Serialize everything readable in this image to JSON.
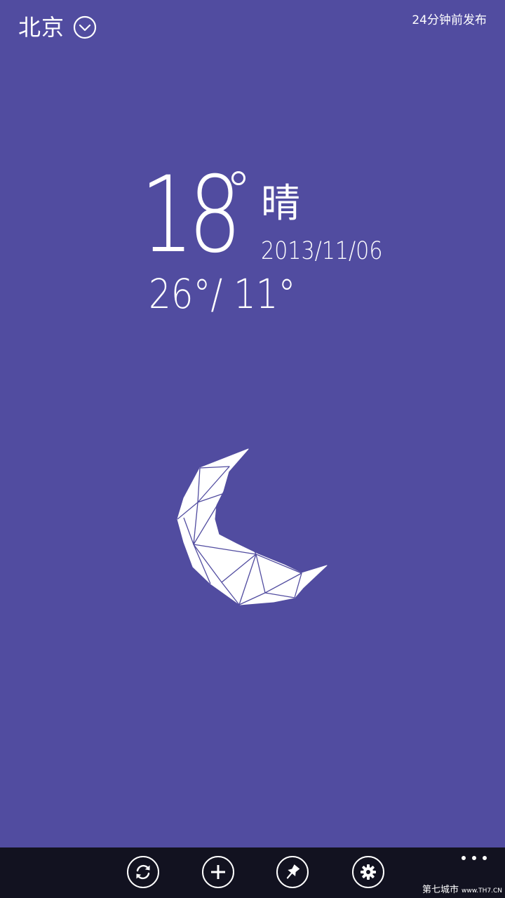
{
  "header": {
    "city": "北京",
    "publish_time": "24分钟前发布"
  },
  "current": {
    "temperature": "18",
    "condition": "晴",
    "date": "2013/11/06",
    "range": "26°/ 11°"
  },
  "icons": {
    "city_dropdown": "chevron-down-circle-icon",
    "weather": "crescent-moon-icon",
    "refresh": "refresh-icon",
    "add": "add-icon",
    "pin": "pin-icon",
    "settings": "gear-icon",
    "more": "ellipsis-icon"
  },
  "watermark": {
    "text": "第七城市",
    "site": "www.TH7.CN"
  },
  "colors": {
    "background": "#514ca0",
    "appbar": "#121220",
    "foreground": "#ffffff"
  }
}
